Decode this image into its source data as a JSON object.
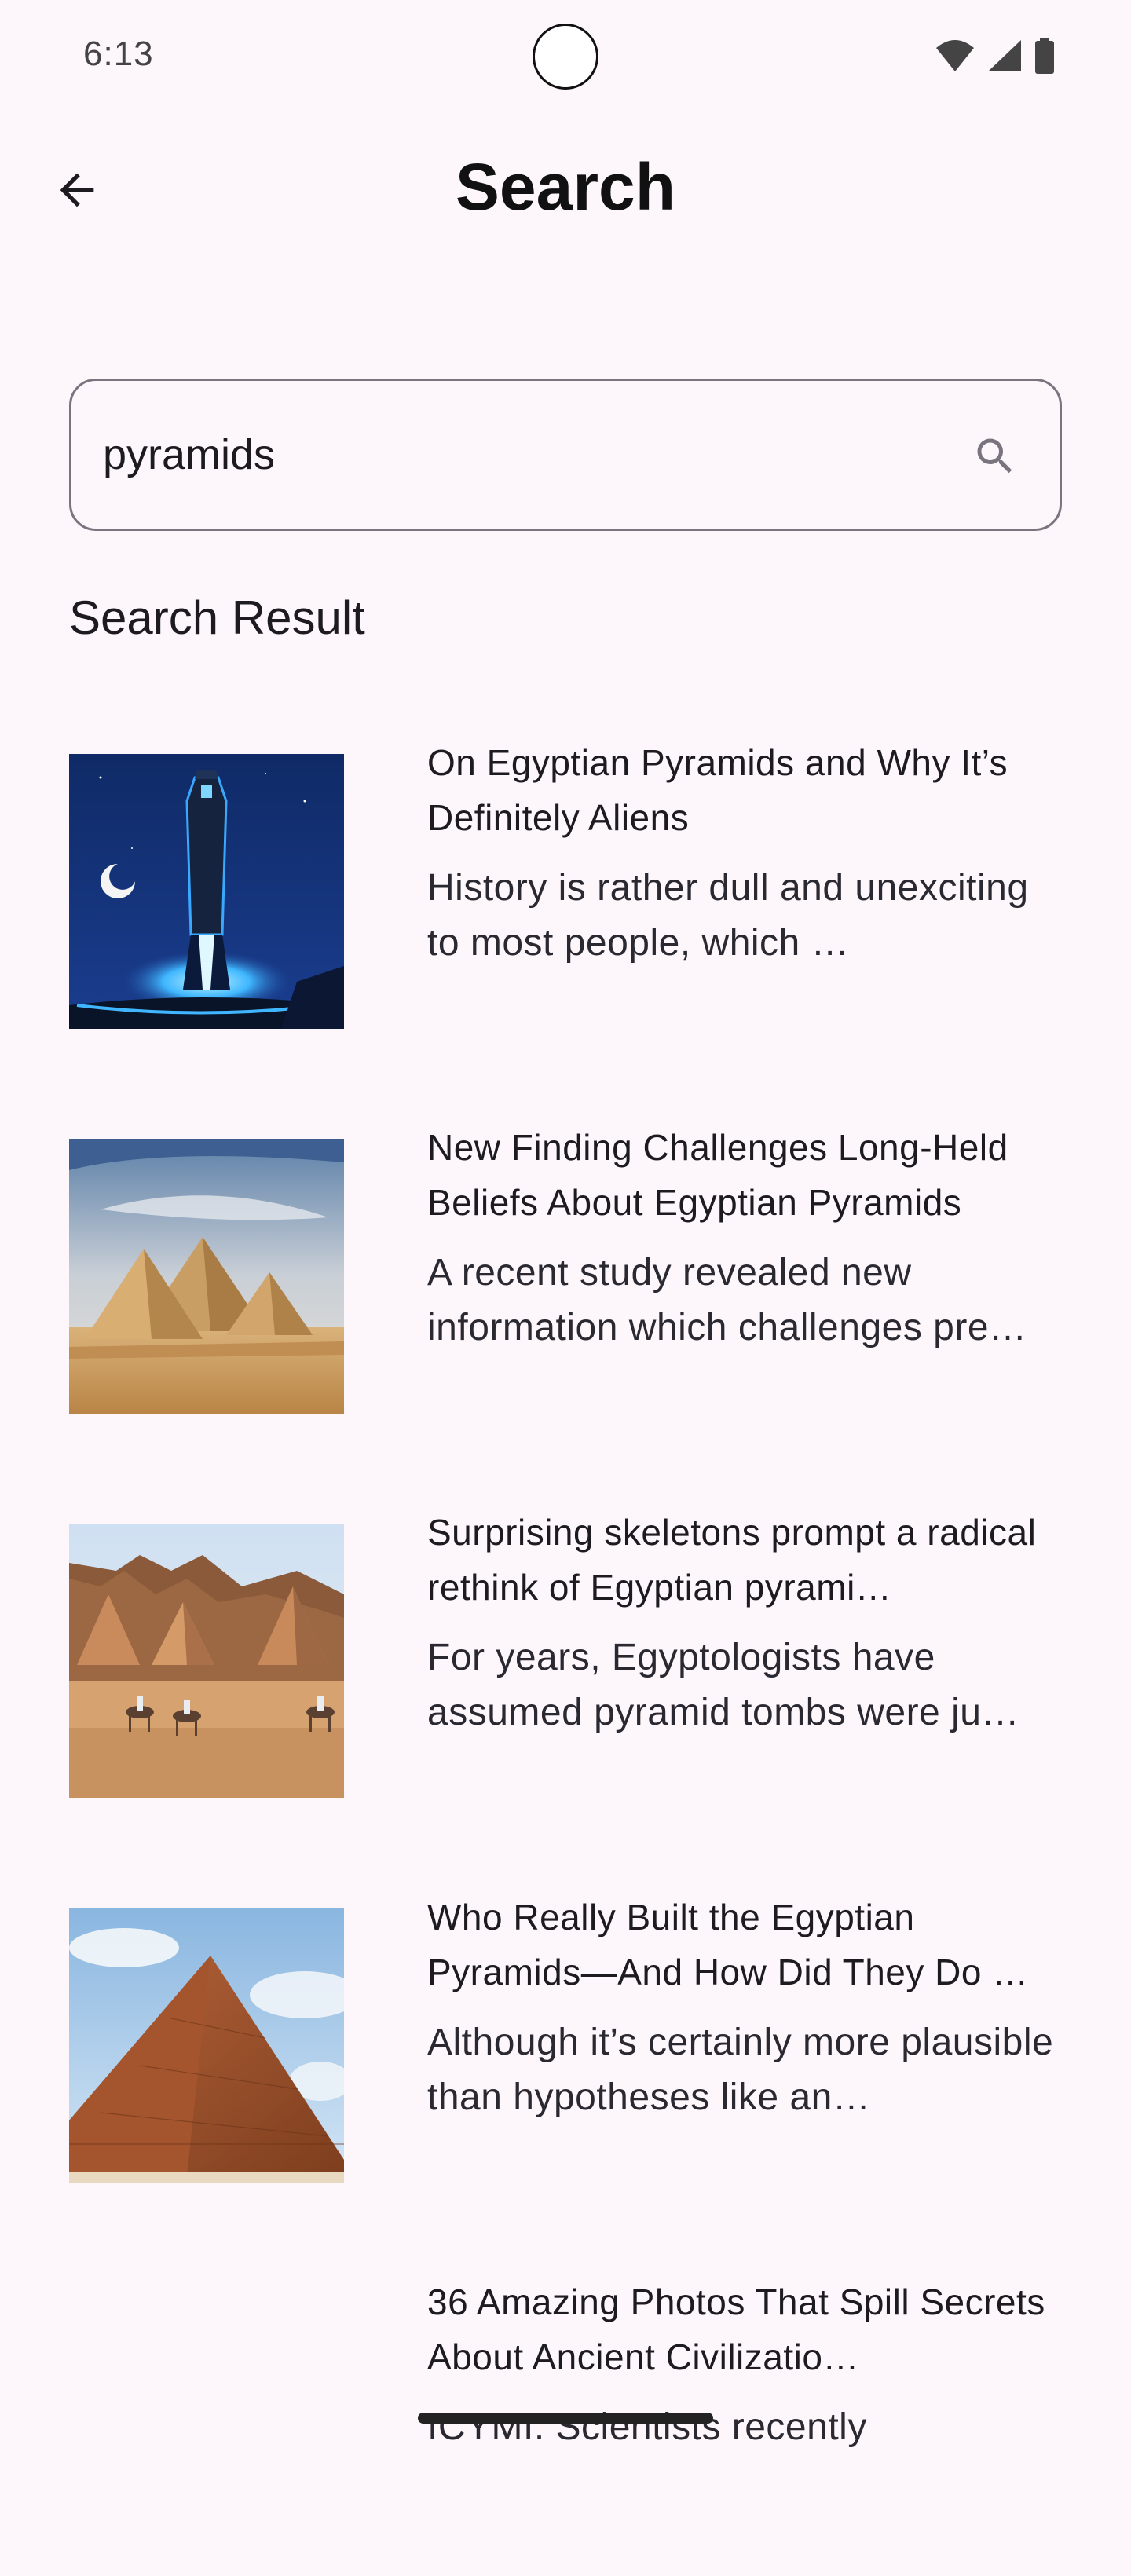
{
  "status_bar": {
    "time": "6:13"
  },
  "app_bar": {
    "title": "Search",
    "back_icon": "arrow-left-icon"
  },
  "search": {
    "value": "pyramids",
    "icon": "search-icon"
  },
  "section": {
    "heading": "Search Result"
  },
  "results": [
    {
      "title": "On Egyptian Pyramids and Why It’s Definitely Aliens",
      "description": "History is rather dull and unexciting to most people, which …",
      "thumbnail": "obelisk-night-illustration"
    },
    {
      "title": "New Finding Challenges Long-Held Beliefs About Egyptian Pyramids",
      "description": "A recent study revealed new information which challenges pre…",
      "thumbnail": "giza-pyramids-desert"
    },
    {
      "title": "Surprising skeletons prompt a radical rethink of Egyptian pyrami…",
      "description": "For years, Egyptologists have assumed pyramid tombs were ju…",
      "thumbnail": "meroe-pyramids-camels"
    },
    {
      "title": "Who Really Built the Egyptian Pyramids—And How Did They Do …",
      "description": "Although it’s certainly more plausible than hypotheses like an…",
      "thumbnail": "great-pyramid-closeup"
    },
    {
      "title": "36 Amazing Photos That Spill Secrets About Ancient Civilizatio…",
      "description": "ICYMI: Scientists recently",
      "thumbnail": "blank"
    }
  ],
  "colors": {
    "background": "#fdf7fc",
    "outline": "#79747e",
    "text": "#1d1b20"
  }
}
